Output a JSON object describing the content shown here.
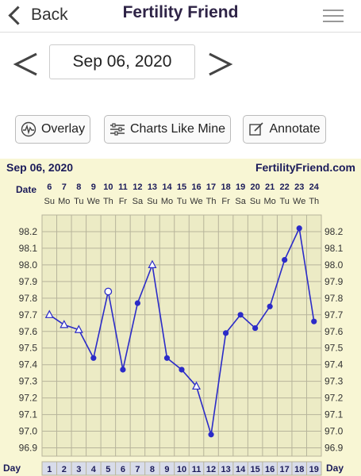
{
  "nav": {
    "back_label": "Back",
    "title": "Fertility Friend"
  },
  "date_selector": {
    "current": "Sep 06, 2020"
  },
  "toolbar": {
    "overlay": "Overlay",
    "charts_like_mine": "Charts Like Mine",
    "annotate": "Annotate"
  },
  "chart_header": {
    "date": "Sep 06, 2020",
    "site": "FertilityFriend.com"
  },
  "row_labels": {
    "date": "Date",
    "day": "Day"
  },
  "colors": {
    "line": "#2b2bc8",
    "chart_bg": "#f8f6d4",
    "plot_bg": "#ecebc5",
    "grid": "#b7b49b",
    "label": "#1b1b5a"
  },
  "chart_data": {
    "type": "line",
    "x_dates": [
      "6",
      "7",
      "8",
      "9",
      "10",
      "11",
      "12",
      "13",
      "14",
      "15",
      "16",
      "17",
      "18",
      "19",
      "20",
      "21",
      "22",
      "23",
      "24"
    ],
    "x_weekdays": [
      "Su",
      "Mo",
      "Tu",
      "We",
      "Th",
      "Fr",
      "Sa",
      "Su",
      "Mo",
      "Tu",
      "We",
      "Th",
      "Fr",
      "Sa",
      "Su",
      "Mo",
      "Tu",
      "We",
      "Th"
    ],
    "x_days": [
      1,
      2,
      3,
      4,
      5,
      6,
      7,
      8,
      9,
      10,
      11,
      12,
      13,
      14,
      15,
      16,
      17,
      18,
      19
    ],
    "y_ticks": [
      "98.2",
      "98.1",
      "98.0",
      "97.9",
      "97.8",
      "97.7",
      "97.6",
      "97.5",
      "97.4",
      "97.3",
      "97.2",
      "97.1",
      "97.0",
      "96.9"
    ],
    "ylim": [
      96.85,
      98.3
    ],
    "series": [
      {
        "values": [
          97.7,
          97.64,
          97.61,
          97.44,
          97.84,
          97.37,
          97.77,
          98.0,
          97.44,
          97.37,
          97.27,
          96.98,
          97.59,
          97.7,
          97.62,
          97.75,
          98.03,
          98.22,
          97.66
        ],
        "markers": [
          "open-triangle",
          "open-triangle",
          "open-triangle",
          "dot",
          "open-circle",
          "dot",
          "dot",
          "open-triangle",
          "dot",
          "dot",
          "open-triangle",
          "dot",
          "dot",
          "dot",
          "dot",
          "dot",
          "dot",
          "dot",
          "dot"
        ]
      }
    ]
  }
}
